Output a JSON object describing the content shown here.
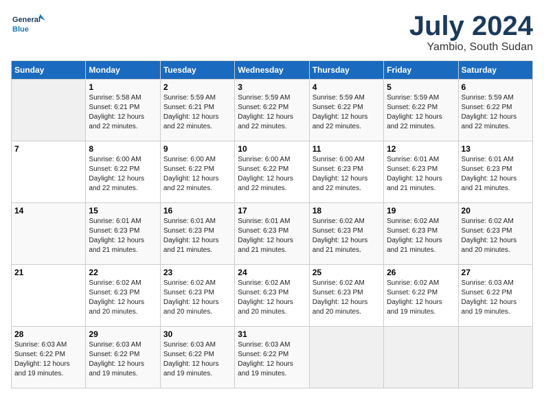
{
  "header": {
    "logo_line1": "General",
    "logo_line2": "Blue",
    "month_year": "July 2024",
    "location": "Yambio, South Sudan"
  },
  "weekdays": [
    "Sunday",
    "Monday",
    "Tuesday",
    "Wednesday",
    "Thursday",
    "Friday",
    "Saturday"
  ],
  "weeks": [
    [
      {
        "day": "",
        "info": ""
      },
      {
        "day": "1",
        "info": "Sunrise: 5:58 AM\nSunset: 6:21 PM\nDaylight: 12 hours\nand 22 minutes."
      },
      {
        "day": "2",
        "info": "Sunrise: 5:59 AM\nSunset: 6:21 PM\nDaylight: 12 hours\nand 22 minutes."
      },
      {
        "day": "3",
        "info": "Sunrise: 5:59 AM\nSunset: 6:22 PM\nDaylight: 12 hours\nand 22 minutes."
      },
      {
        "day": "4",
        "info": "Sunrise: 5:59 AM\nSunset: 6:22 PM\nDaylight: 12 hours\nand 22 minutes."
      },
      {
        "day": "5",
        "info": "Sunrise: 5:59 AM\nSunset: 6:22 PM\nDaylight: 12 hours\nand 22 minutes."
      },
      {
        "day": "6",
        "info": "Sunrise: 5:59 AM\nSunset: 6:22 PM\nDaylight: 12 hours\nand 22 minutes."
      }
    ],
    [
      {
        "day": "7",
        "info": ""
      },
      {
        "day": "8",
        "info": "Sunrise: 6:00 AM\nSunset: 6:22 PM\nDaylight: 12 hours\nand 22 minutes."
      },
      {
        "day": "9",
        "info": "Sunrise: 6:00 AM\nSunset: 6:22 PM\nDaylight: 12 hours\nand 22 minutes."
      },
      {
        "day": "10",
        "info": "Sunrise: 6:00 AM\nSunset: 6:22 PM\nDaylight: 12 hours\nand 22 minutes."
      },
      {
        "day": "11",
        "info": "Sunrise: 6:00 AM\nSunset: 6:23 PM\nDaylight: 12 hours\nand 22 minutes."
      },
      {
        "day": "12",
        "info": "Sunrise: 6:01 AM\nSunset: 6:23 PM\nDaylight: 12 hours\nand 21 minutes."
      },
      {
        "day": "13",
        "info": "Sunrise: 6:01 AM\nSunset: 6:23 PM\nDaylight: 12 hours\nand 21 minutes."
      }
    ],
    [
      {
        "day": "14",
        "info": ""
      },
      {
        "day": "15",
        "info": "Sunrise: 6:01 AM\nSunset: 6:23 PM\nDaylight: 12 hours\nand 21 minutes."
      },
      {
        "day": "16",
        "info": "Sunrise: 6:01 AM\nSunset: 6:23 PM\nDaylight: 12 hours\nand 21 minutes."
      },
      {
        "day": "17",
        "info": "Sunrise: 6:01 AM\nSunset: 6:23 PM\nDaylight: 12 hours\nand 21 minutes."
      },
      {
        "day": "18",
        "info": "Sunrise: 6:02 AM\nSunset: 6:23 PM\nDaylight: 12 hours\nand 21 minutes."
      },
      {
        "day": "19",
        "info": "Sunrise: 6:02 AM\nSunset: 6:23 PM\nDaylight: 12 hours\nand 21 minutes."
      },
      {
        "day": "20",
        "info": "Sunrise: 6:02 AM\nSunset: 6:23 PM\nDaylight: 12 hours\nand 20 minutes."
      }
    ],
    [
      {
        "day": "21",
        "info": ""
      },
      {
        "day": "22",
        "info": "Sunrise: 6:02 AM\nSunset: 6:23 PM\nDaylight: 12 hours\nand 20 minutes."
      },
      {
        "day": "23",
        "info": "Sunrise: 6:02 AM\nSunset: 6:23 PM\nDaylight: 12 hours\nand 20 minutes."
      },
      {
        "day": "24",
        "info": "Sunrise: 6:02 AM\nSunset: 6:23 PM\nDaylight: 12 hours\nand 20 minutes."
      },
      {
        "day": "25",
        "info": "Sunrise: 6:02 AM\nSunset: 6:23 PM\nDaylight: 12 hours\nand 20 minutes."
      },
      {
        "day": "26",
        "info": "Sunrise: 6:02 AM\nSunset: 6:22 PM\nDaylight: 12 hours\nand 19 minutes."
      },
      {
        "day": "27",
        "info": "Sunrise: 6:03 AM\nSunset: 6:22 PM\nDaylight: 12 hours\nand 19 minutes."
      }
    ],
    [
      {
        "day": "28",
        "info": "Sunrise: 6:03 AM\nSunset: 6:22 PM\nDaylight: 12 hours\nand 19 minutes."
      },
      {
        "day": "29",
        "info": "Sunrise: 6:03 AM\nSunset: 6:22 PM\nDaylight: 12 hours\nand 19 minutes."
      },
      {
        "day": "30",
        "info": "Sunrise: 6:03 AM\nSunset: 6:22 PM\nDaylight: 12 hours\nand 19 minutes."
      },
      {
        "day": "31",
        "info": "Sunrise: 6:03 AM\nSunset: 6:22 PM\nDaylight: 12 hours\nand 19 minutes."
      },
      {
        "day": "",
        "info": ""
      },
      {
        "day": "",
        "info": ""
      },
      {
        "day": "",
        "info": ""
      }
    ]
  ]
}
